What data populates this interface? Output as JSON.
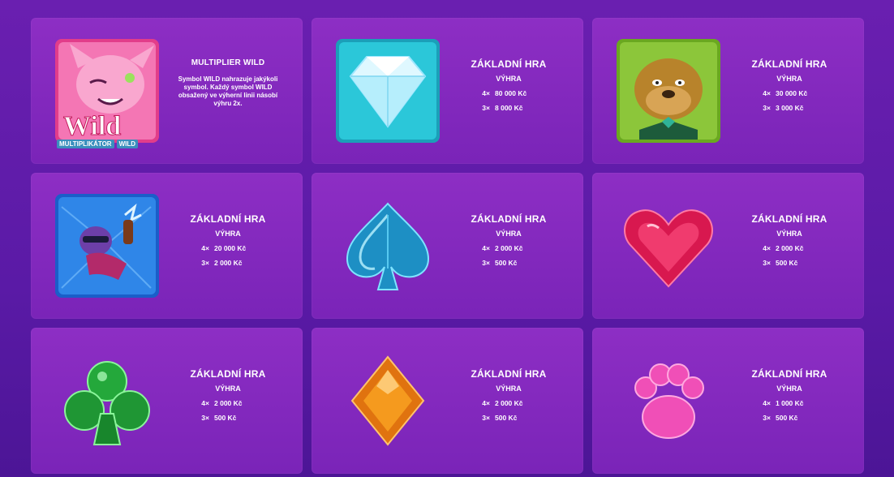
{
  "cards": [
    {
      "symbol": "wild-cat-icon",
      "title": "MULTIPLIER WILD",
      "description": "Symbol WILD nahrazuje jakýkoli symbol. Každý symbol WILD obsažený ve výherní linii násobí výhru 2x.",
      "badge_left": "MULTIPLIKÁTOR",
      "badge_right": "WILD"
    },
    {
      "symbol": "diamond-icon",
      "title": "ZÁKLADNÍ HRA",
      "subtitle": "VÝHRA",
      "pays": [
        {
          "count": "4×",
          "value": "80 000 Kč"
        },
        {
          "count": "3×",
          "value": "8 000 Kč"
        }
      ]
    },
    {
      "symbol": "bulldog-icon",
      "title": "ZÁKLADNÍ HRA",
      "subtitle": "VÝHRA",
      "pays": [
        {
          "count": "4×",
          "value": "30 000 Kč"
        },
        {
          "count": "3×",
          "value": "3 000 Kč"
        }
      ]
    },
    {
      "symbol": "hero-cat-icon",
      "title": "ZÁKLADNÍ HRA",
      "subtitle": "VÝHRA",
      "pays": [
        {
          "count": "4×",
          "value": "20 000 Kč"
        },
        {
          "count": "3×",
          "value": "2 000 Kč"
        }
      ]
    },
    {
      "symbol": "spade-gem-icon",
      "title": "ZÁKLADNÍ HRA",
      "subtitle": "VÝHRA",
      "pays": [
        {
          "count": "4×",
          "value": "2 000 Kč"
        },
        {
          "count": "3×",
          "value": "500 Kč"
        }
      ]
    },
    {
      "symbol": "heart-gem-icon",
      "title": "ZÁKLADNÍ HRA",
      "subtitle": "VÝHRA",
      "pays": [
        {
          "count": "4×",
          "value": "2 000 Kč"
        },
        {
          "count": "3×",
          "value": "500 Kč"
        }
      ]
    },
    {
      "symbol": "club-gem-icon",
      "title": "ZÁKLADNÍ HRA",
      "subtitle": "VÝHRA",
      "pays": [
        {
          "count": "4×",
          "value": "2 000 Kč"
        },
        {
          "count": "3×",
          "value": "500 Kč"
        }
      ]
    },
    {
      "symbol": "diamond-gem-icon",
      "title": "ZÁKLADNÍ HRA",
      "subtitle": "VÝHRA",
      "pays": [
        {
          "count": "4×",
          "value": "2 000 Kč"
        },
        {
          "count": "3×",
          "value": "500 Kč"
        }
      ]
    },
    {
      "symbol": "paw-icon",
      "title": "ZÁKLADNÍ HRA",
      "subtitle": "VÝHRA",
      "pays": [
        {
          "count": "4×",
          "value": "1 000 Kč"
        },
        {
          "count": "3×",
          "value": "500 Kč"
        }
      ]
    }
  ]
}
